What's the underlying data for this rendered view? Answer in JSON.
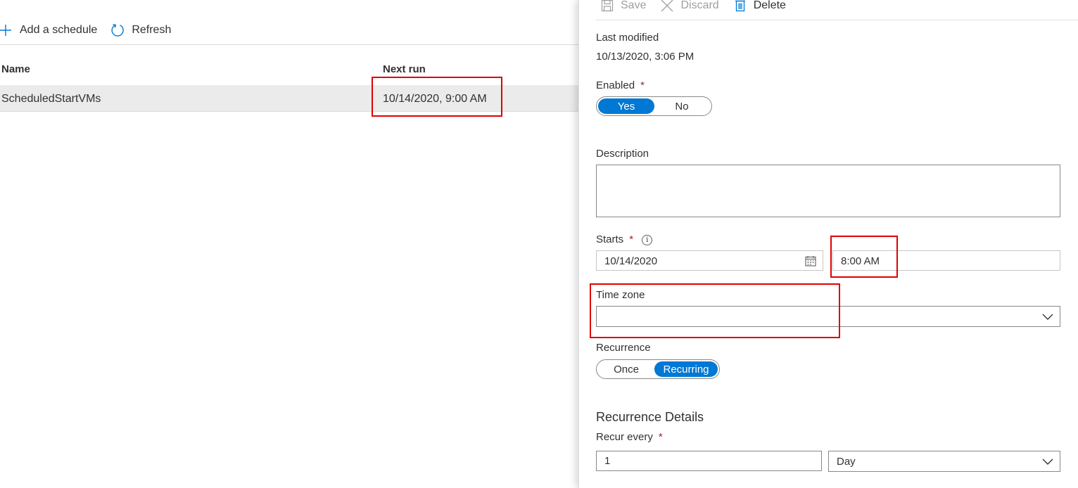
{
  "toolbar": {
    "add_label": "Add a schedule",
    "refresh_label": "Refresh"
  },
  "grid": {
    "columns": {
      "name": "Name",
      "next_run": "Next run"
    },
    "rows": [
      {
        "name": "ScheduledStartVMs",
        "next_run": "10/14/2020, 9:00 AM"
      }
    ]
  },
  "panel": {
    "toolbar": {
      "save": "Save",
      "discard": "Discard",
      "delete": "Delete"
    },
    "last_modified": {
      "label": "Last modified",
      "value": "10/13/2020, 3:06 PM"
    },
    "enabled": {
      "label": "Enabled",
      "required_mark": "*",
      "options": [
        "Yes",
        "No"
      ],
      "selected": "Yes"
    },
    "description": {
      "label": "Description",
      "value": ""
    },
    "starts": {
      "label": "Starts",
      "required_mark": "*",
      "info_glyph": "i",
      "date": "10/14/2020",
      "time": "8:00 AM"
    },
    "time_zone": {
      "label": "Time zone",
      "value": ""
    },
    "recurrence": {
      "label": "Recurrence",
      "options": [
        "Once",
        "Recurring"
      ],
      "selected": "Recurring"
    },
    "recurrence_details": {
      "title": "Recurrence Details",
      "recur_every_label": "Recur every",
      "required_mark": "*",
      "interval": "1",
      "unit": "Day"
    }
  },
  "colors": {
    "accent": "#0078d4",
    "required": "#a4262c",
    "highlight_box": "#e00000",
    "selected_row": "#ebebeb"
  }
}
